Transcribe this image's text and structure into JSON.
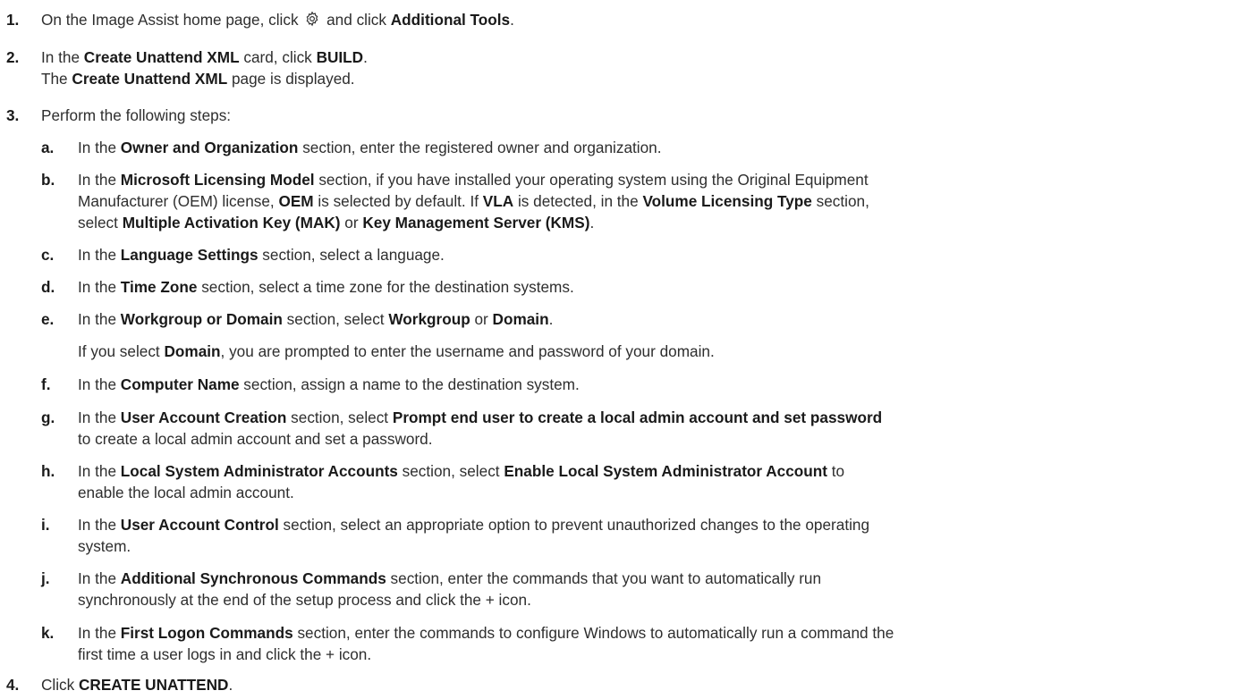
{
  "steps": [
    {
      "number": "1.",
      "parts": [
        "On the Image Assist home page, click ",
        " and click ",
        "Additional Tools",
        "."
      ],
      "icon": "gear-icon"
    },
    {
      "number": "2.",
      "parts": [
        "In the ",
        "Create Unattend XML",
        " card, click ",
        "BUILD",
        "."
      ],
      "result_parts": [
        "The ",
        "Create Unattend XML",
        " page is displayed."
      ]
    },
    {
      "number": "3.",
      "text": "Perform the following steps:",
      "substeps": [
        {
          "letter": "a.",
          "lines": [
            [
              "In the ",
              "Owner and Organization",
              " section, enter the registered owner and organization."
            ]
          ]
        },
        {
          "letter": "b.",
          "lines": [
            [
              "In the ",
              "Microsoft Licensing Model",
              " section, if you have installed your operating system using the Original Equipment"
            ],
            [
              "Manufacturer (OEM) license, ",
              "OEM",
              " is selected by default. If ",
              "VLA",
              " is detected, in the ",
              "Volume Licensing Type",
              " section,"
            ],
            [
              "select ",
              "Multiple Activation Key (MAK)",
              " or ",
              "Key Management Server (KMS)",
              "."
            ]
          ]
        },
        {
          "letter": "c.",
          "lines": [
            [
              "In the ",
              "Language Settings",
              " section, select a language."
            ]
          ]
        },
        {
          "letter": "d.",
          "lines": [
            [
              "In the ",
              "Time Zone",
              " section, select a time zone for the destination systems."
            ]
          ]
        },
        {
          "letter": "e.",
          "lines": [
            [
              "In the ",
              "Workgroup or Domain",
              " section, select ",
              "Workgroup",
              " or ",
              "Domain",
              "."
            ]
          ],
          "note": [
            "If you select ",
            "Domain",
            ", you are prompted to enter the username and password of your domain."
          ]
        },
        {
          "letter": "f.",
          "lines": [
            [
              "In the ",
              "Computer Name",
              " section, assign a name to the destination system."
            ]
          ]
        },
        {
          "letter": "g.",
          "lines": [
            [
              "In the ",
              "User Account Creation",
              " section, select ",
              "Prompt end user to create a local admin account and set password"
            ],
            [
              "to create a local admin account and set a password."
            ]
          ]
        },
        {
          "letter": "h.",
          "lines": [
            [
              "In the ",
              "Local System Administrator Accounts",
              " section, select ",
              "Enable Local System Administrator Account",
              " to"
            ],
            [
              "enable the local admin account."
            ]
          ]
        },
        {
          "letter": "i.",
          "lines": [
            [
              "In the ",
              "User Account Control",
              " section, select an appropriate option to prevent unauthorized changes to the operating"
            ],
            [
              "system."
            ]
          ]
        },
        {
          "letter": "j.",
          "lines": [
            [
              "In the ",
              "Additional Synchronous Commands",
              " section, enter the commands that you want to automatically run"
            ],
            [
              "synchronously at the end of the setup process and click the + icon."
            ]
          ]
        },
        {
          "letter": "k.",
          "lines": [
            [
              "In the ",
              "First Logon Commands",
              " section, enter the commands to configure Windows to automatically run a command the"
            ],
            [
              "first time a user logs in and click the + icon."
            ]
          ]
        }
      ]
    },
    {
      "number": "4.",
      "parts": [
        "Click ",
        "CREATE UNATTEND",
        "."
      ]
    }
  ]
}
